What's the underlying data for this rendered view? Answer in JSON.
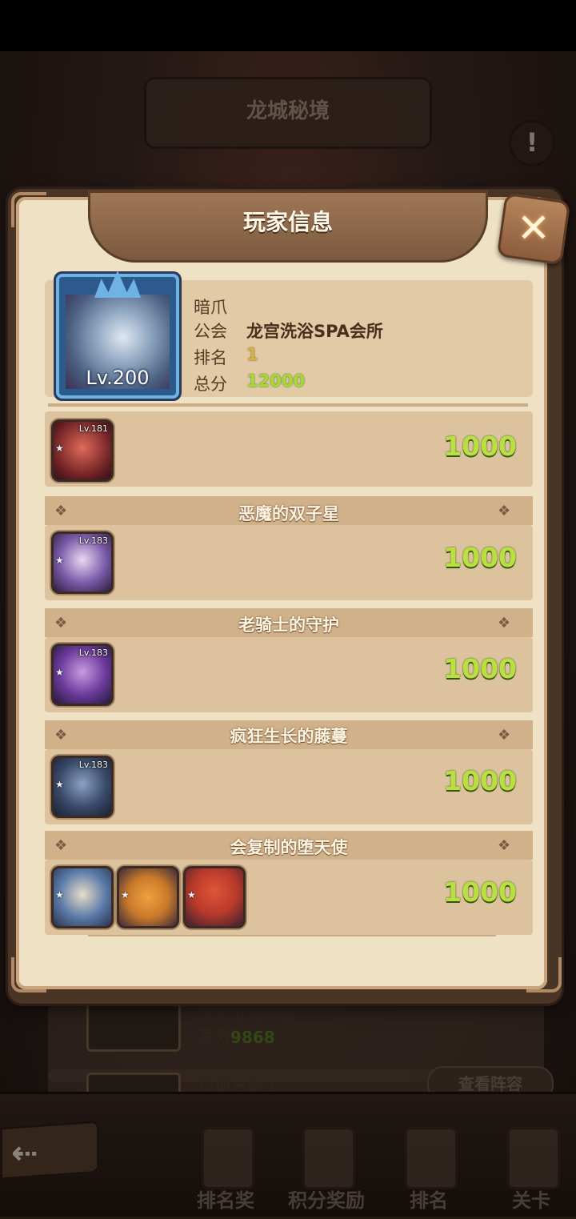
{
  "background": {
    "title": "龙城秘境",
    "alert_icon": "exclamation-icon",
    "rows": [
      {
        "name": "会会浴光乐园",
        "score_label": "总分",
        "score": "9868"
      },
      {
        "name": "巨坝女魔头"
      }
    ],
    "view_lineup": "查看阵容"
  },
  "bottom_nav": {
    "back_icon": "back-arrow-icon",
    "tabs": [
      {
        "label": "排名奖"
      },
      {
        "label": "积分奖励"
      },
      {
        "label": "排名"
      },
      {
        "label": "关卡"
      }
    ]
  },
  "dialog": {
    "title": "玩家信息",
    "close_icon": "close-x-icon",
    "player": {
      "name": "暗爪",
      "level": "Lv.200",
      "guild_label": "公会",
      "guild": "龙宫洗浴SPA会所",
      "rank_label": "排名",
      "rank": "1",
      "score_label": "总分",
      "score": "12000"
    },
    "teams": [
      {
        "title": "",
        "score": "1000",
        "heroes": [
          {
            "lv": "Lv.181",
            "color": "#b03a3a"
          }
        ]
      },
      {
        "title": "恶魔的双子星",
        "score": "1000",
        "heroes": [
          {
            "lv": "Lv.183",
            "color": "#5a4a8a"
          }
        ]
      },
      {
        "title": "老骑士的守护",
        "score": "1000",
        "heroes": [
          {
            "lv": "Lv.183",
            "color": "#6a4a9a"
          }
        ]
      },
      {
        "title": "疯狂生长的藤蔓",
        "score": "1000",
        "heroes": [
          {
            "lv": "Lv.183",
            "color": "#3a4a6a"
          }
        ]
      },
      {
        "title": "会复制的堕天使",
        "score": "1000",
        "heroes": [
          {
            "lv": "",
            "color": "#5a7aa8"
          },
          {
            "lv": "",
            "color": "#c87a2a"
          },
          {
            "lv": "",
            "color": "#b83a2a"
          }
        ]
      }
    ]
  },
  "colors": {
    "panel_bg": "#efe2c4",
    "score_green": "#b8e040",
    "frame_blue": "#6fb2e4"
  }
}
